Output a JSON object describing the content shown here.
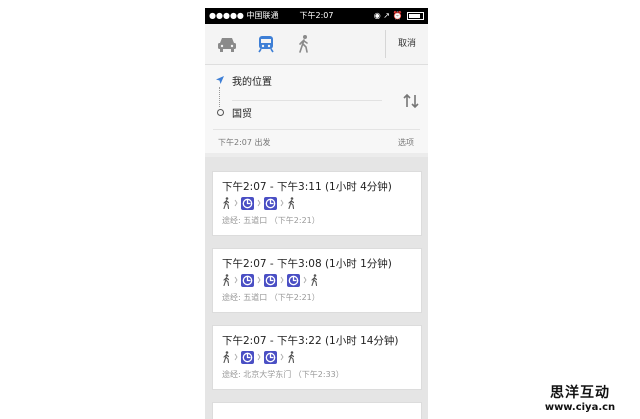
{
  "status_bar": {
    "signal": "●●●●● 中国联通",
    "time": "下午2:07",
    "right": "◉ ↗ ⏰"
  },
  "mode_bar": {
    "modes": [
      {
        "name": "car",
        "icon": "car-icon",
        "selected": false
      },
      {
        "name": "transit",
        "icon": "train-icon",
        "selected": true
      },
      {
        "name": "walk",
        "icon": "walking-person-icon",
        "selected": false
      }
    ],
    "cancel_label": "取消",
    "selected_color": "#3e7fd6"
  },
  "route": {
    "origin": "我的位置",
    "destination": "国贸",
    "depart": "下午2:07 出发",
    "options_label": "选项"
  },
  "results": [
    {
      "time_range": "下午2:07 - 下午3:11 (1小时 4分钟)",
      "legs": [
        "walk",
        "metro",
        "metro",
        "walk"
      ],
      "via": "途经:  五道口 （下午2:21）"
    },
    {
      "time_range": "下午2:07 - 下午3:08 (1小时 1分钟)",
      "legs": [
        "walk",
        "metro",
        "metro",
        "metro",
        "walk"
      ],
      "via": "途经:  五道口 （下午2:21）"
    },
    {
      "time_range": "下午2:07 - 下午3:22 (1小时 14分钟)",
      "legs": [
        "walk",
        "metro",
        "metro",
        "walk"
      ],
      "via": "途经:  北京大学东门 （下午2:33）"
    }
  ],
  "metro_color": "#4a4fc4",
  "watermark": {
    "cn": "思洋互动",
    "url": "www.ciya.cn"
  }
}
